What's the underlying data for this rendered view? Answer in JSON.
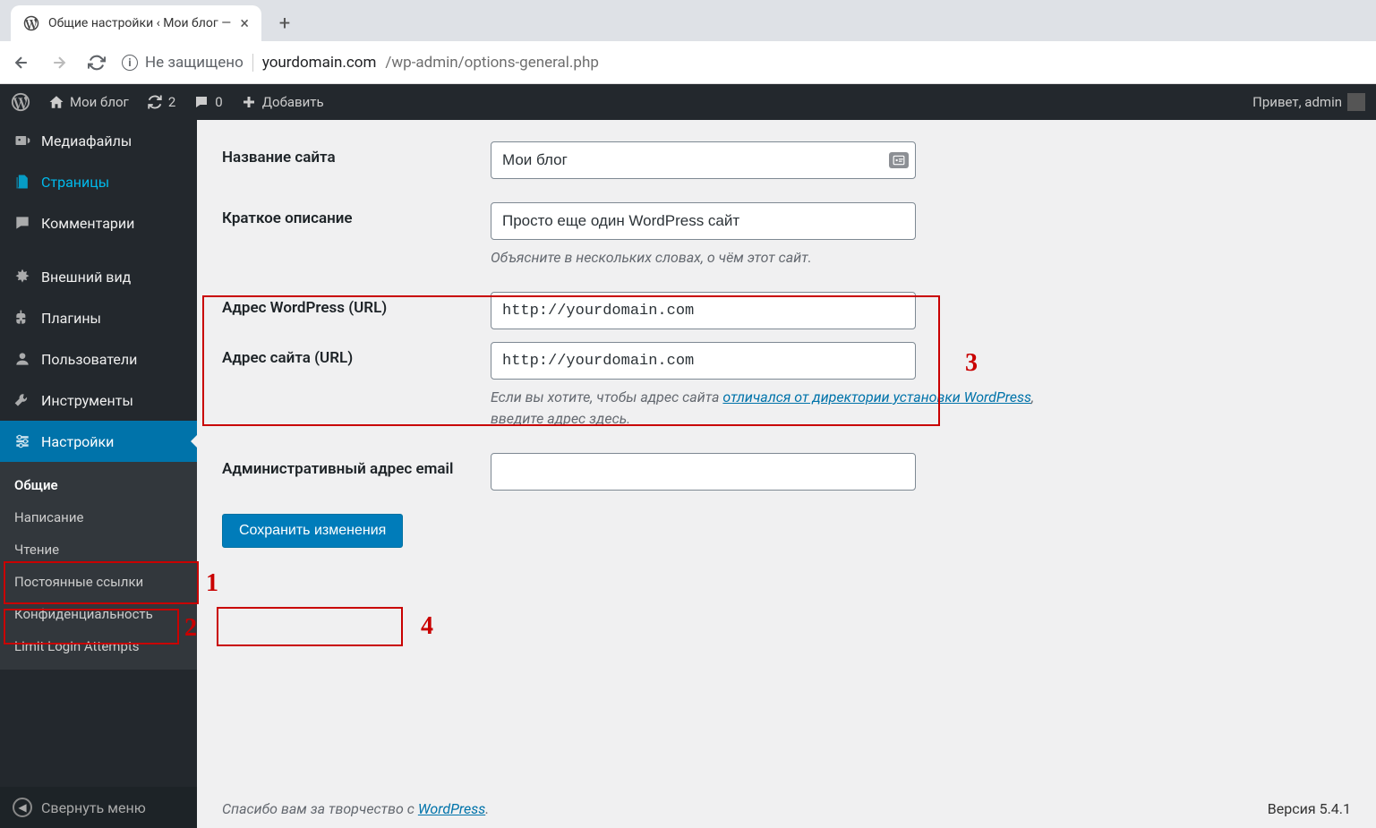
{
  "browser": {
    "tab_title": "Общие настройки ‹ Мои блог —",
    "insecure_label": "Не защищено",
    "url_host": "yourdomain.com",
    "url_path": "/wp-admin/options-general.php"
  },
  "adminbar": {
    "site_name": "Мои блог",
    "updates_count": "2",
    "comments_count": "0",
    "new_label": "Добавить",
    "greeting": "Привет, admin"
  },
  "sidebar": {
    "media": "Медиафайлы",
    "pages": "Страницы",
    "comments": "Комментарии",
    "appearance": "Внешний вид",
    "plugins": "Плагины",
    "users": "Пользователи",
    "tools": "Инструменты",
    "settings": "Настройки",
    "sub_general": "Общие",
    "sub_writing": "Написание",
    "sub_reading": "Чтение",
    "sub_permalinks": "Постоянные ссылки",
    "sub_privacy": "Конфиденциальность",
    "sub_lla": "Limit Login Attempts",
    "collapse": "Свернуть меню"
  },
  "form": {
    "site_title_label": "Название сайта",
    "site_title_value": "Мои блог",
    "tagline_label": "Краткое описание",
    "tagline_value": "Просто еще один WordPress сайт",
    "tagline_desc": "Объясните в нескольких словах, о чём этот сайт.",
    "wp_url_label": "Адрес WordPress (URL)",
    "wp_url_value": "http://yourdomain.com",
    "site_url_label": "Адрес сайта (URL)",
    "site_url_value": "http://yourdomain.com",
    "site_url_desc_1": "Если вы хотите, чтобы адрес сайта ",
    "site_url_desc_link": "отличался от директории установки WordPress",
    "site_url_desc_2": ", введите адрес здесь.",
    "admin_email_label": "Административный адрес email",
    "admin_email_value": "",
    "submit": "Сохранить изменения"
  },
  "footer": {
    "thanks_1": "Спасибо вам за творчество с ",
    "thanks_link": "WordPress",
    "version": "Версия 5.4.1"
  },
  "annotations": {
    "n1": "1",
    "n2": "2",
    "n3": "3",
    "n4": "4"
  }
}
